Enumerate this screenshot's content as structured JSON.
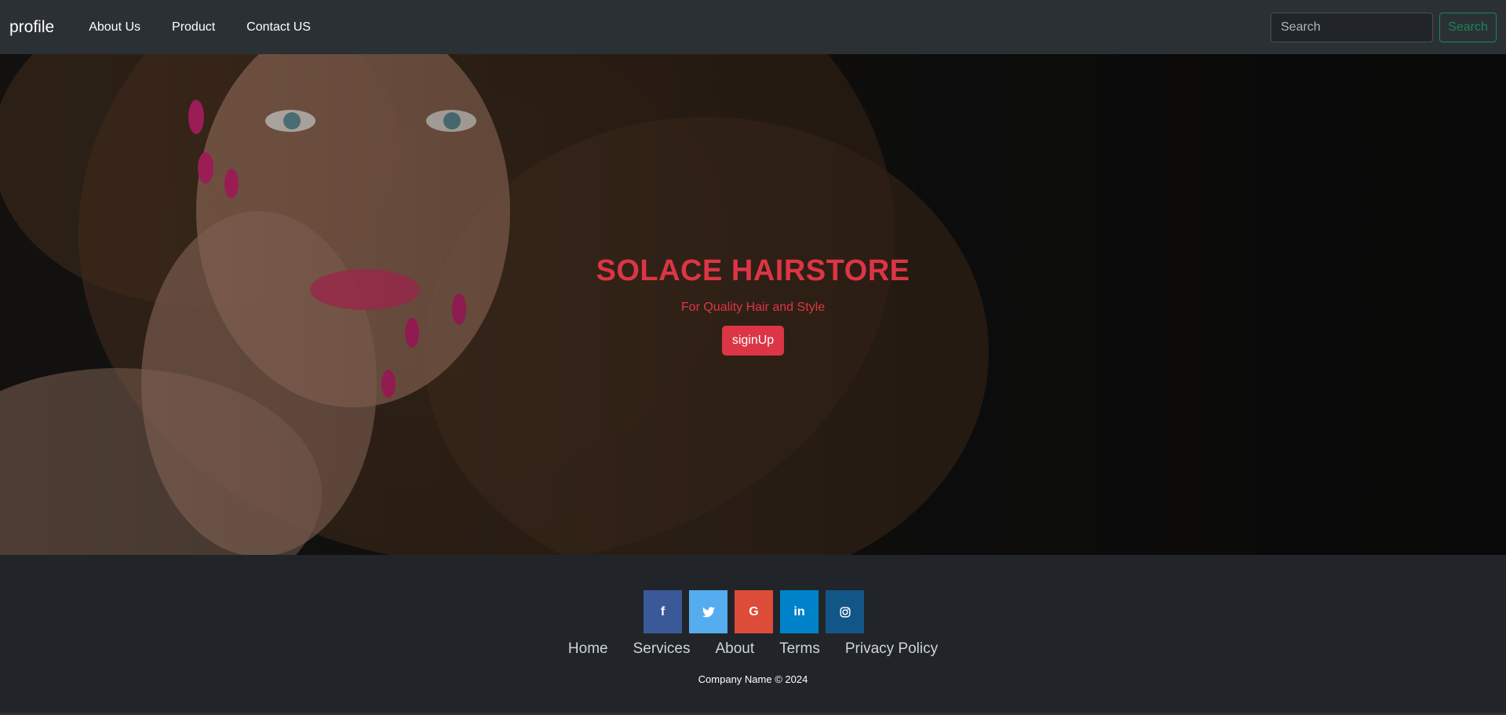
{
  "navbar": {
    "brand": "profile",
    "links": [
      "About Us",
      "Product",
      "Contact US"
    ],
    "search_placeholder": "Search",
    "search_button": "Search"
  },
  "hero": {
    "title": "SOLACE HAIRSTORE",
    "subtitle": "For Quality Hair and Style",
    "signup_label": "siginUp"
  },
  "footer": {
    "social": [
      {
        "icon": "facebook-icon",
        "glyph": "f",
        "color": "#3b5998"
      },
      {
        "icon": "twitter-icon",
        "glyph": "🐦",
        "color": "#55acee"
      },
      {
        "icon": "google-icon",
        "glyph": "G",
        "color": "#dd4b39"
      },
      {
        "icon": "linkedin-icon",
        "glyph": "in",
        "color": "#0082ca"
      },
      {
        "icon": "instagram-icon",
        "glyph": "◎",
        "color": "#125688"
      }
    ],
    "links": [
      "Home",
      "Services",
      "About",
      "Terms",
      "Privacy Policy"
    ],
    "copyright": "Company Name © 2024"
  },
  "colors": {
    "accent_red": "#dc3545",
    "accent_green": "#198754",
    "navbar_bg": "#2b3035",
    "footer_bg": "#212529"
  }
}
